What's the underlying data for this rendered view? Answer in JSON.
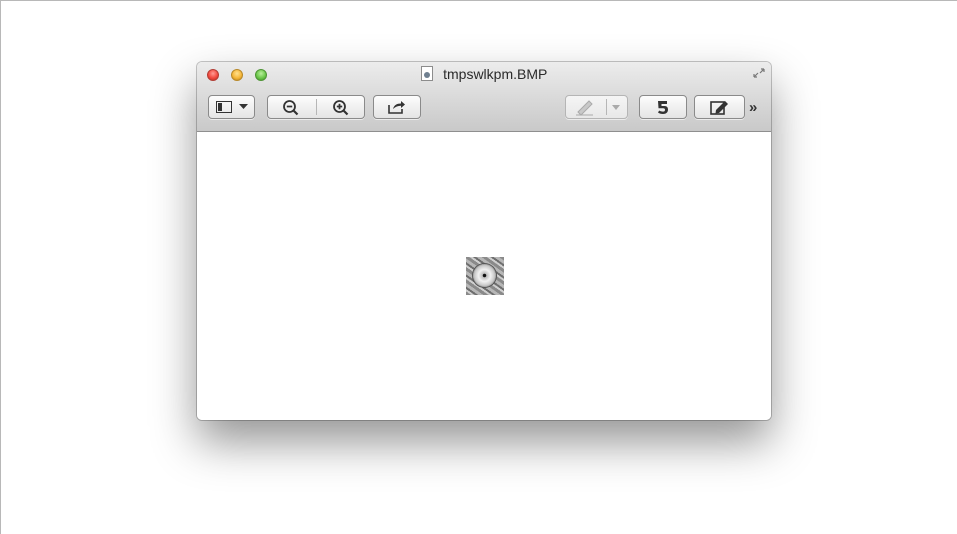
{
  "window": {
    "title": "tmpswlkpm.BMP",
    "file_icon": "bmp-document-icon"
  },
  "toolbar": {
    "sidebar_button_icons": [
      "sidebar-icon",
      "chevron-down-icon"
    ],
    "zoom_out_icon": "zoom-out-icon",
    "zoom_in_icon": "zoom-in-icon",
    "share_icon": "share-icon",
    "markup_pen_icon": "pen-icon",
    "rotate_icon": "rotate-icon",
    "edit_icon": "edit-toolbar-icon",
    "overflow_label": "»"
  },
  "content": {
    "image_description_icon": "image-thumbnail"
  },
  "colors": {
    "close": "#f24a3f",
    "minimize": "#f6b73a",
    "zoom": "#6cc84b"
  }
}
